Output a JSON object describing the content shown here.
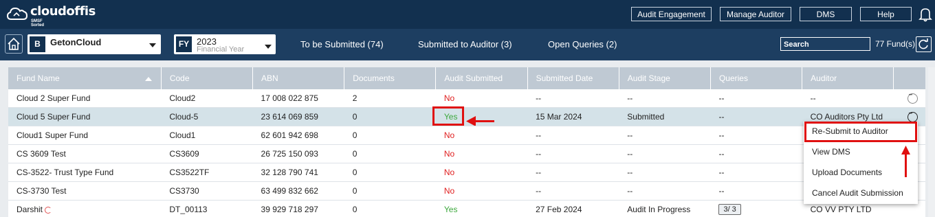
{
  "brand": {
    "name": "cloudoffis",
    "tagline": "SMSF Sorted"
  },
  "topnav": {
    "audit_engagement": "Audit Engagement",
    "manage_auditor": "Manage Auditor",
    "dms": "DMS",
    "help": "Help"
  },
  "entity": {
    "badge": "B",
    "name": "GetonCloud"
  },
  "year": {
    "badge": "FY",
    "value": "2023",
    "caption": "Financial Year"
  },
  "tabs": {
    "to_submit": "To be Submitted (74)",
    "submitted": "Submitted to Auditor (3)",
    "open_queries": "Open Queries (2)"
  },
  "search": {
    "placeholder": "Search"
  },
  "fund_count": "77 Fund(s)",
  "columns": [
    "Fund Name",
    "Code",
    "ABN",
    "Documents",
    "Audit Submitted",
    "Submitted Date",
    "Audit Stage",
    "Queries",
    "Auditor"
  ],
  "rows": [
    {
      "fund": "Cloud 2 Super Fund",
      "code": "Cloud2",
      "abn": "17 008 022 875",
      "docs": "2",
      "submitted": "No",
      "date": "--",
      "stage": "--",
      "queries": "--",
      "auditor": "--"
    },
    {
      "fund": "Cloud 5 Super Fund",
      "code": "Cloud-5",
      "abn": "23 614 069 859",
      "docs": "0",
      "submitted": "Yes",
      "date": "15 Mar 2024",
      "stage": "Submitted",
      "queries": "--",
      "auditor": "CO Auditors Pty Ltd"
    },
    {
      "fund": "Cloud1 Super Fund",
      "code": "Cloud1",
      "abn": "62 601 942 698",
      "docs": "0",
      "submitted": "No",
      "date": "--",
      "stage": "--",
      "queries": "--",
      "auditor": ""
    },
    {
      "fund": "CS 3609 Test",
      "code": "CS3609",
      "abn": "26 725 150 093",
      "docs": "0",
      "submitted": "No",
      "date": "--",
      "stage": "--",
      "queries": "--",
      "auditor": ""
    },
    {
      "fund": "CS-3522- Trust Type Fund",
      "code": "CS3522TF",
      "abn": "32 128 790 741",
      "docs": "0",
      "submitted": "No",
      "date": "--",
      "stage": "--",
      "queries": "--",
      "auditor": ""
    },
    {
      "fund": "CS-3730 Test",
      "code": "CS3730",
      "abn": "63 499 832 662",
      "docs": "0",
      "submitted": "No",
      "date": "--",
      "stage": "--",
      "queries": "--",
      "auditor": ""
    },
    {
      "fund": "Darshit",
      "code": "DT_00113",
      "abn": "39 929 718 297",
      "docs": "0",
      "submitted": "Yes",
      "date": "27 Feb 2024",
      "stage": "Audit In Progress",
      "queries": "3/ 3",
      "auditor": "CO VV PTY LTD"
    }
  ],
  "menu": {
    "resubmit": "Re-Submit to Auditor",
    "view_dms": "View DMS",
    "upload": "Upload Documents",
    "cancel": "Cancel Audit Submission"
  },
  "colors": {
    "header_bg": "#12304f",
    "subheader_bg": "#1d3e61",
    "no": "#e02020",
    "yes": "#3ca83c",
    "highlight": "#e01010"
  }
}
